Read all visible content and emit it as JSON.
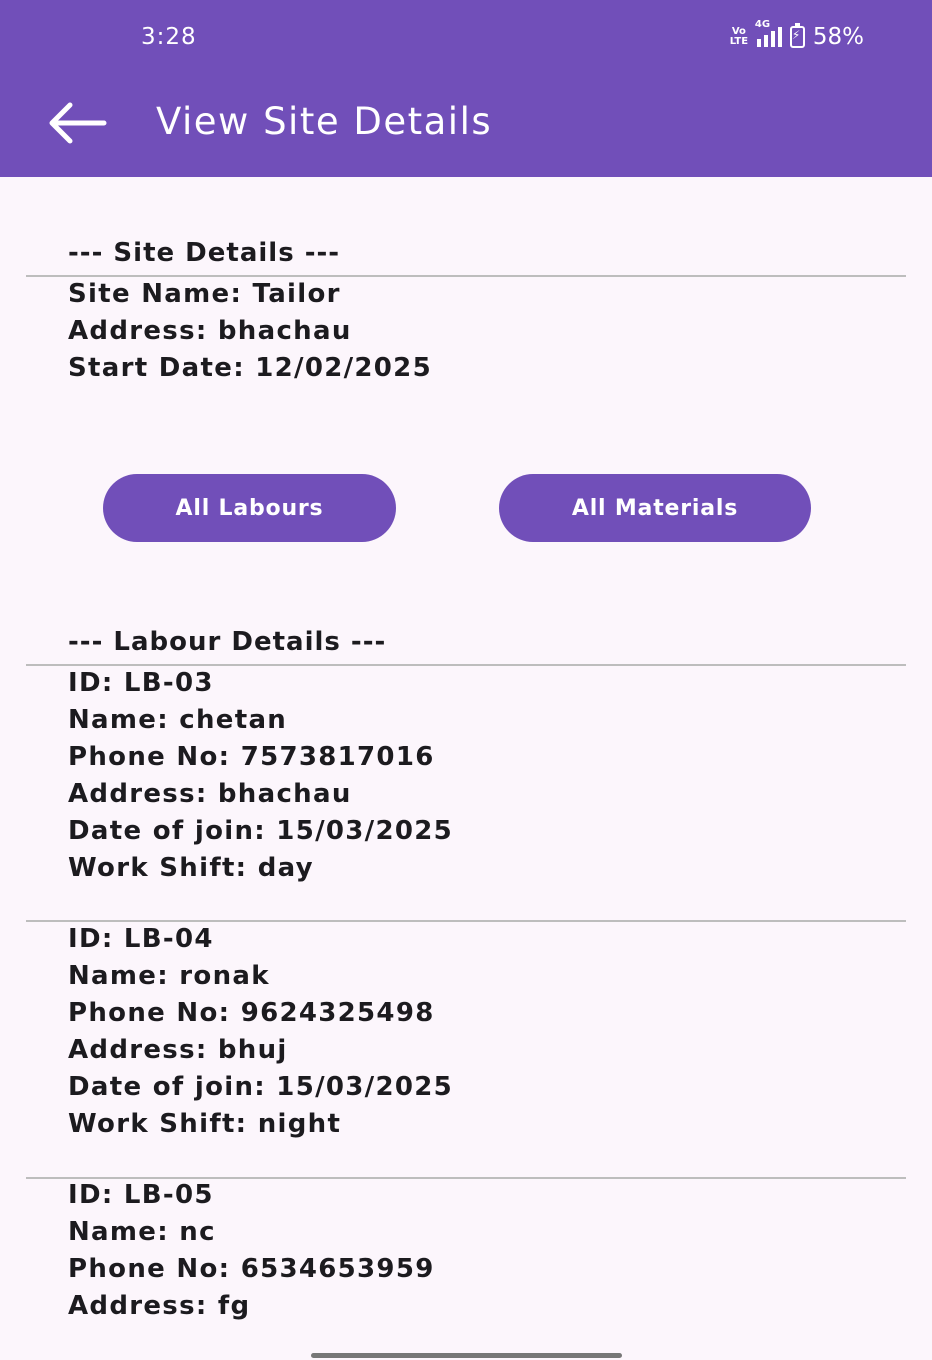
{
  "status_bar": {
    "time": "3:28",
    "volte": "Vo LTE",
    "network": "4G",
    "battery": "58%"
  },
  "app_bar": {
    "title": "View Site Details"
  },
  "site": {
    "heading": "--- Site Details ---",
    "name": "Site Name: Tailor",
    "address": "Address: bhachau",
    "start_date": "Start Date: 12/02/2025"
  },
  "buttons": {
    "labours": "All Labours",
    "materials": "All Materials"
  },
  "labour_section": {
    "heading": "--- Labour Details ---"
  },
  "labours": [
    {
      "id": "ID: LB-03",
      "name": "Name: chetan",
      "phone": "Phone No: 7573817016",
      "address": "Address: bhachau",
      "join": "Date of join: 15/03/2025",
      "shift": "Work Shift: day"
    },
    {
      "id": "ID: LB-04",
      "name": "Name: ronak",
      "phone": "Phone No: 9624325498",
      "address": "Address: bhuj",
      "join": "Date of join: 15/03/2025",
      "shift": "Work Shift: night"
    },
    {
      "id": "ID: LB-05",
      "name": "Name: nc",
      "phone": "Phone No: 6534653959",
      "address": "Address: fg"
    }
  ],
  "colors": {
    "primary": "#714fb9",
    "background": "#fcf6fc",
    "divider": "#bdbdbd"
  }
}
